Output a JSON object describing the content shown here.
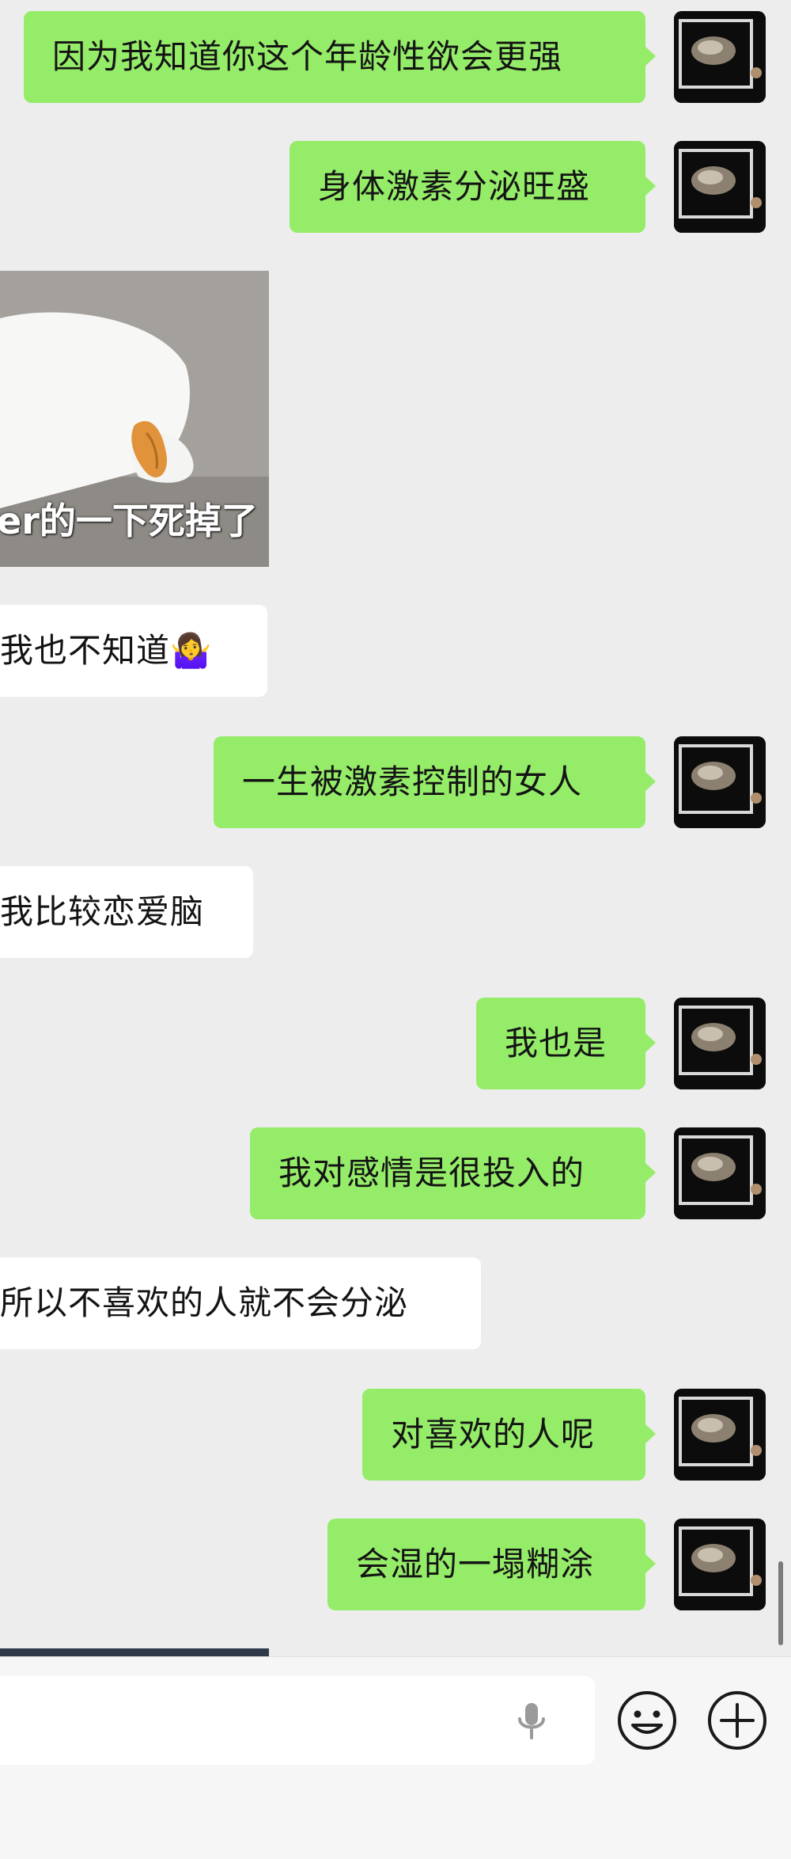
{
  "messages": [
    {
      "from": "me",
      "text": "因为我知道你这个年龄性欲会更强"
    },
    {
      "from": "me",
      "text": "身体激素分泌旺盛"
    },
    {
      "from": "them",
      "type": "sticker",
      "caption": "er的一下死掉了"
    },
    {
      "from": "them",
      "text": "我也不知道🤷‍♀️"
    },
    {
      "from": "me",
      "text": "一生被激素控制的女人"
    },
    {
      "from": "them",
      "text": "我比较恋爱脑"
    },
    {
      "from": "me",
      "text": "我也是"
    },
    {
      "from": "me",
      "text": "我对感情是很投入的"
    },
    {
      "from": "them",
      "text": "所以不喜欢的人就不会分泌"
    },
    {
      "from": "me",
      "text": "对喜欢的人呢"
    },
    {
      "from": "me",
      "text": "会湿的一塌糊涂"
    }
  ],
  "input_bar": {
    "text_value": "",
    "placeholder": "",
    "voice_icon": "microphone-icon",
    "emoji_icon": "smiley-face-icon",
    "more_icon": "plus-circle-icon"
  },
  "colors": {
    "background": "#ededed",
    "my_bubble": "#95ec69",
    "their_bubble": "#ffffff"
  }
}
